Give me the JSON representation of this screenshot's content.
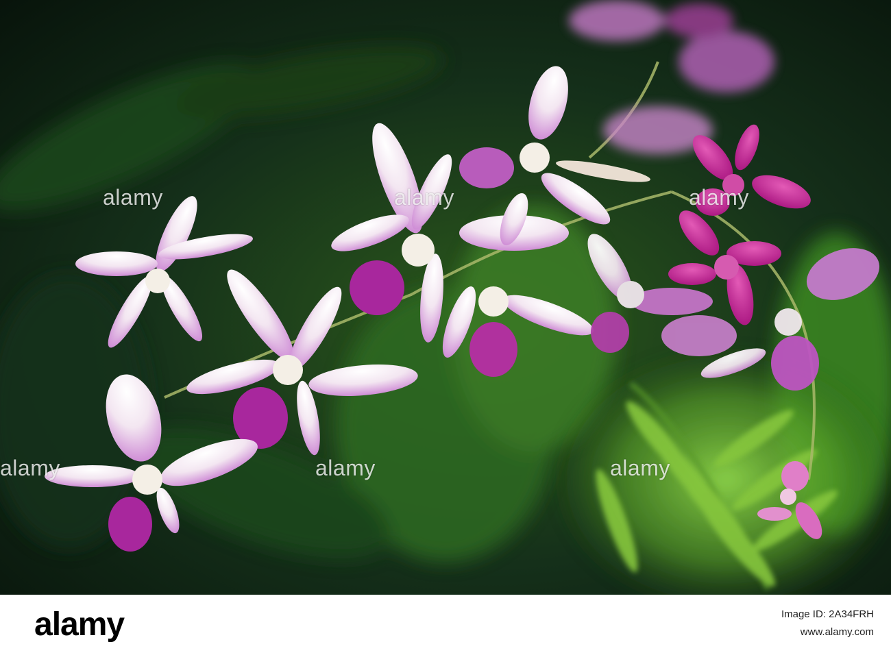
{
  "photo": {
    "subject": "orchids",
    "colors": {
      "background": "#0e1a10",
      "foliage_dark": "#143018",
      "foliage_light": "#7bc93a",
      "petal_white": "#f6f2f4",
      "petal_lavender": "#c880d0",
      "petal_magenta": "#c21e92"
    }
  },
  "watermark": {
    "text": "alamy"
  },
  "footer": {
    "logo": "alamy",
    "image_id": "Image ID: 2A34FRH",
    "url": "www.alamy.com"
  }
}
